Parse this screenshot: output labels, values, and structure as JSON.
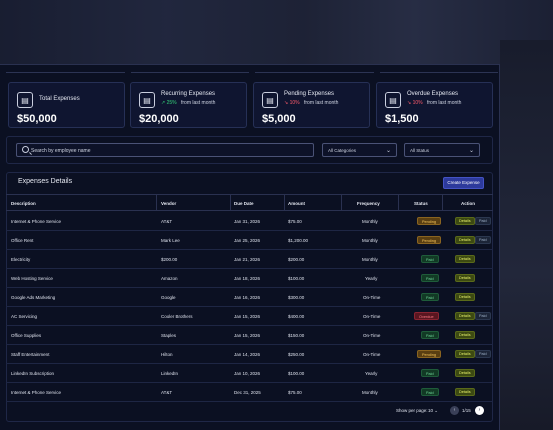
{
  "cards": [
    {
      "title": "Total Expenses",
      "trend": "",
      "trend_dir": "",
      "trend_sub": "",
      "value": "$50,000"
    },
    {
      "title": "Recurring Expenses",
      "trend": "25%",
      "trend_dir": "up",
      "trend_sub": "from last month",
      "value": "$20,000"
    },
    {
      "title": "Pending Expenses",
      "trend": "10%",
      "trend_dir": "down",
      "trend_sub": "from last month",
      "value": "$5,000"
    },
    {
      "title": "Overdue Expenses",
      "trend": "10%",
      "trend_dir": "down",
      "trend_sub": "from last month",
      "value": "$1,500"
    }
  ],
  "filters": {
    "search_placeholder": "Search by employee name",
    "category": "All Categories",
    "status": "All Status"
  },
  "table": {
    "title": "Expenses Details",
    "create_label": "Create Expense",
    "headers": [
      "Description",
      "Vendor",
      "Due Date",
      "Amount",
      "Frequency",
      "Status",
      "Action"
    ],
    "rows": [
      {
        "description": "Internet & Phone Service",
        "vendor": "AT&T",
        "due": "Jan 31, 2026",
        "amount": "$75.00",
        "frequency": "Monthly",
        "status": "Pending",
        "details": "Details",
        "paid": "Paid"
      },
      {
        "description": "Office Rent",
        "vendor": "Mark Lee",
        "due": "Jan 25, 2026",
        "amount": "$1,200.00",
        "frequency": "Monthly",
        "status": "Pending",
        "details": "Details",
        "paid": "Paid"
      },
      {
        "description": "Electricity",
        "vendor": "$200.00",
        "due": "Jan 21, 2026",
        "amount": "$200.00",
        "frequency": "Monthly",
        "status": "Paid",
        "details": "Details",
        "paid": ""
      },
      {
        "description": "Web Hosting Service",
        "vendor": "Amazon",
        "due": "Jan 18, 2026",
        "amount": "$100.00",
        "frequency": "Yearly",
        "status": "Paid",
        "details": "Details",
        "paid": ""
      },
      {
        "description": "Google Ads Marketing",
        "vendor": "Google",
        "due": "Jan 16, 2026",
        "amount": "$300.00",
        "frequency": "On-Time",
        "status": "Paid",
        "details": "Details",
        "paid": ""
      },
      {
        "description": "AC Servicing",
        "vendor": "Cooler Brothers",
        "due": "Jan 15, 2026",
        "amount": "$400.00",
        "frequency": "On-Time",
        "status": "Overdue",
        "details": "Details",
        "paid": "Paid"
      },
      {
        "description": "Office Supplies",
        "vendor": "Staples",
        "due": "Jan 15, 2026",
        "amount": "$150.00",
        "frequency": "On-Time",
        "status": "Paid",
        "details": "Details",
        "paid": ""
      },
      {
        "description": "Staff Entertainment",
        "vendor": "Hilton",
        "due": "Jan 14, 2026",
        "amount": "$250.00",
        "frequency": "On-Time",
        "status": "Pending",
        "details": "Details",
        "paid": "Paid"
      },
      {
        "description": "LinkedIn Subscription",
        "vendor": "LinkedIn",
        "due": "Jan 10, 2026",
        "amount": "$100.00",
        "frequency": "Yearly",
        "status": "Paid",
        "details": "Details",
        "paid": ""
      },
      {
        "description": "Internet & Phone Service",
        "vendor": "AT&T",
        "due": "Dec 31, 2025",
        "amount": "$75.00",
        "frequency": "Monthly",
        "status": "Paid",
        "details": "Details",
        "paid": ""
      }
    ]
  },
  "pagination": {
    "label": "Show per page:",
    "per_page": "10",
    "info": "1/15"
  },
  "colors": {
    "background": "#0b1022",
    "accent": "#2d3a9c",
    "pending": "#f4c35a",
    "paid": "#6fd79a",
    "overdue": "#ff7a86",
    "details": "#e6f06a"
  },
  "icons": {
    "card": "receipt-icon",
    "search": "search-icon",
    "dropdown": "chevron-down-icon",
    "trend_up": "trend-up-icon",
    "trend_down": "trend-down-icon"
  }
}
